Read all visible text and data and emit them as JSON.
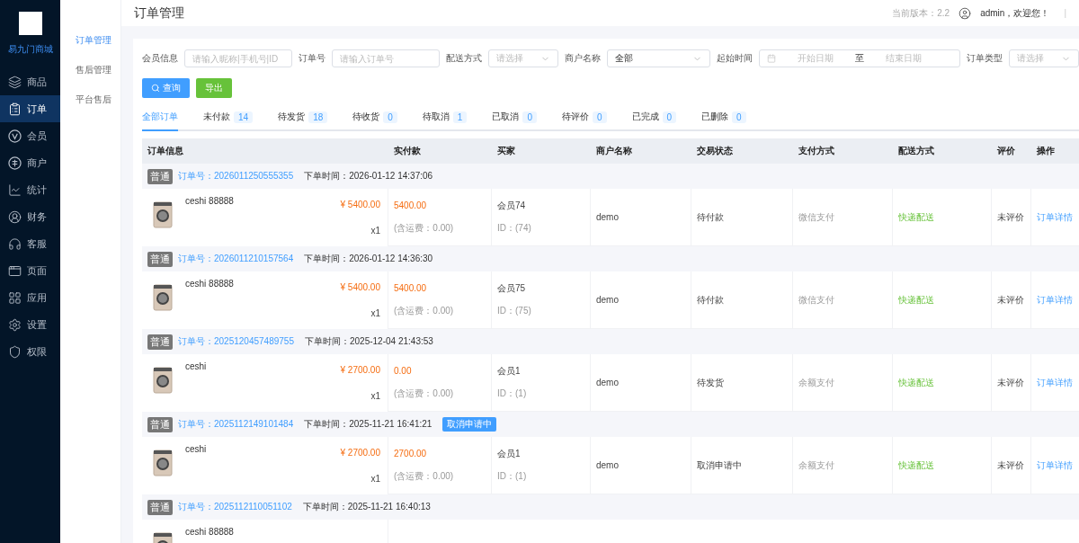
{
  "brand": {
    "name": "易九门商城"
  },
  "sidebar": {
    "items": [
      {
        "label": "商品",
        "selected": false
      },
      {
        "label": "订单",
        "selected": true
      },
      {
        "label": "会员",
        "selected": false
      },
      {
        "label": "商户",
        "selected": false
      },
      {
        "label": "统计",
        "selected": false
      },
      {
        "label": "财务",
        "selected": false
      },
      {
        "label": "客服",
        "selected": false
      },
      {
        "label": "页面",
        "selected": false
      },
      {
        "label": "应用",
        "selected": false
      },
      {
        "label": "设置",
        "selected": false
      },
      {
        "label": "权限",
        "selected": false
      }
    ]
  },
  "subnav": {
    "items": [
      {
        "label": "订单管理",
        "selected": true
      },
      {
        "label": "售后管理",
        "selected": false
      },
      {
        "label": "平台售后",
        "selected": false
      }
    ]
  },
  "header": {
    "title": "订单管理",
    "version": "当前版本：2.2",
    "user": "admin，欢迎您！",
    "separator": "|"
  },
  "filters": [
    {
      "kind": "input",
      "label": "会员信息",
      "placeholder": "请输入昵称|手机号|ID"
    },
    {
      "kind": "input",
      "label": "订单号",
      "placeholder": "请输入订单号"
    },
    {
      "kind": "select",
      "label": "配送方式",
      "placeholder": "请选择"
    },
    {
      "kind": "select",
      "label": "商户名称",
      "value": "全部"
    },
    {
      "kind": "daterange",
      "label": "起始时间",
      "start_placeholder": "开始日期",
      "separator": "至",
      "end_placeholder": "结束日期"
    },
    {
      "kind": "select",
      "label": "订单类型",
      "placeholder": "请选择"
    }
  ],
  "buttons": [
    {
      "kind": "primary",
      "label": "查询"
    },
    {
      "kind": "success",
      "label": "导出"
    }
  ],
  "tabs": [
    {
      "label": "全部订单",
      "selected": true
    },
    {
      "label": "未付款",
      "count": "14",
      "selected": false
    },
    {
      "label": "待发货",
      "count": "18",
      "selected": false
    },
    {
      "label": "待收货",
      "count": "0",
      "selected": false
    },
    {
      "label": "待取消",
      "count": "1",
      "selected": false
    },
    {
      "label": "已取消",
      "count": "0",
      "selected": false
    },
    {
      "label": "待评价",
      "count": "0",
      "selected": false
    },
    {
      "label": "已完成",
      "count": "0",
      "selected": false
    },
    {
      "label": "已删除",
      "count": "0",
      "selected": false
    }
  ],
  "table": {
    "columns": [
      "订单信息",
      "实付款",
      "买家",
      "商户名称",
      "交易状态",
      "支付方式",
      "配送方式",
      "评价",
      "操作"
    ],
    "orders": [
      {
        "type": "普通",
        "order_no": "订单号：2026011250555355",
        "time": "下单时间：2026-01-12 14:37:06",
        "product": "ceshi 88888",
        "price": "¥ 5400.00",
        "qty": "x1",
        "paid": "5400.00",
        "shipping": "(含运费：0.00)",
        "buyer": "会员74",
        "buyer_id": "ID：(74)",
        "merchant": "demo",
        "status": "待付款",
        "payment": "微信支付",
        "delivery": "快递配送",
        "review": "未评价",
        "action": "订单详情"
      },
      {
        "type": "普通",
        "order_no": "订单号：2026011210157564",
        "time": "下单时间：2026-01-12 14:36:30",
        "product": "ceshi 88888",
        "price": "¥ 5400.00",
        "qty": "x1",
        "paid": "5400.00",
        "shipping": "(含运费：0.00)",
        "buyer": "会员75",
        "buyer_id": "ID：(75)",
        "merchant": "demo",
        "status": "待付款",
        "payment": "微信支付",
        "delivery": "快递配送",
        "review": "未评价",
        "action": "订单详情"
      },
      {
        "type": "普通",
        "order_no": "订单号：2025120457489755",
        "time": "下单时间：2025-12-04 21:43:53",
        "product": "ceshi",
        "price": "¥ 2700.00",
        "qty": "x1",
        "paid": "0.00",
        "shipping": "(含运费：0.00)",
        "buyer": "会员1",
        "buyer_id": "ID：(1)",
        "merchant": "demo",
        "status": "待发货",
        "payment": "余额支付",
        "delivery": "快递配送",
        "review": "未评价",
        "action": "订单详情"
      },
      {
        "type": "普通",
        "order_no": "订单号：2025112149101484",
        "time": "下单时间：2025-11-21 16:41:21",
        "status_tag": "取消申请中",
        "product": "ceshi",
        "price": "¥ 2700.00",
        "qty": "x1",
        "paid": "2700.00",
        "shipping": "(含运费：0.00)",
        "buyer": "会员1",
        "buyer_id": "ID：(1)",
        "merchant": "demo",
        "status": "取消申请中",
        "payment": "余额支付",
        "delivery": "快递配送",
        "review": "未评价",
        "action": "订单详情"
      },
      {
        "type": "普通",
        "order_no": "订单号：2025112110051102",
        "time": "下单时间：2025-11-21 16:40:13",
        "product": "ceshi 88888"
      }
    ]
  }
}
